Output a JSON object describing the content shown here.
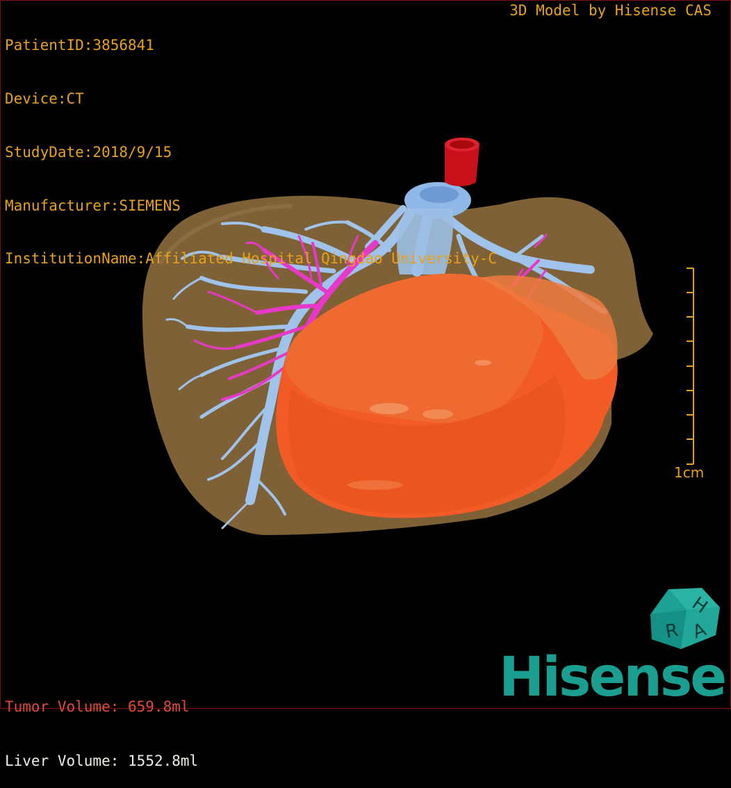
{
  "header": {
    "patient_id": "PatientID:3856841",
    "device": "Device:CT",
    "study_date": "StudyDate:2018/9/15",
    "manufacturer": "Manufacturer:SIEMENS",
    "institution": "InstitutionName:Affiliated Hospital Qingdao University-C",
    "credit": "3D Model by Hisense CAS"
  },
  "volumes": {
    "tumor_label": "Tumor Volume:",
    "tumor_value": " 659.8ml",
    "liver_label": "Liver Volume:",
    "liver_value": "1552.8ml"
  },
  "scale": {
    "label": "1cm"
  },
  "orientation_cube": {
    "letters": [
      "H",
      "R",
      "A"
    ]
  },
  "brand": {
    "logo": "Hisense"
  },
  "colors": {
    "text_accent": "#e8a21a",
    "tumor_text": "#e04a3a",
    "liver_text": "#f0ece6",
    "liver": "#8c6a3c",
    "tumor": "#f25a26",
    "hepatic_vein": "#9fc3ea",
    "portal_vein": "#e838c8",
    "aorta": "#c8101a",
    "cube": "#1a9e90",
    "brand": "#1a9e90"
  },
  "structures": [
    "liver",
    "tumor",
    "hepatic-vein",
    "portal-vein",
    "aorta"
  ]
}
